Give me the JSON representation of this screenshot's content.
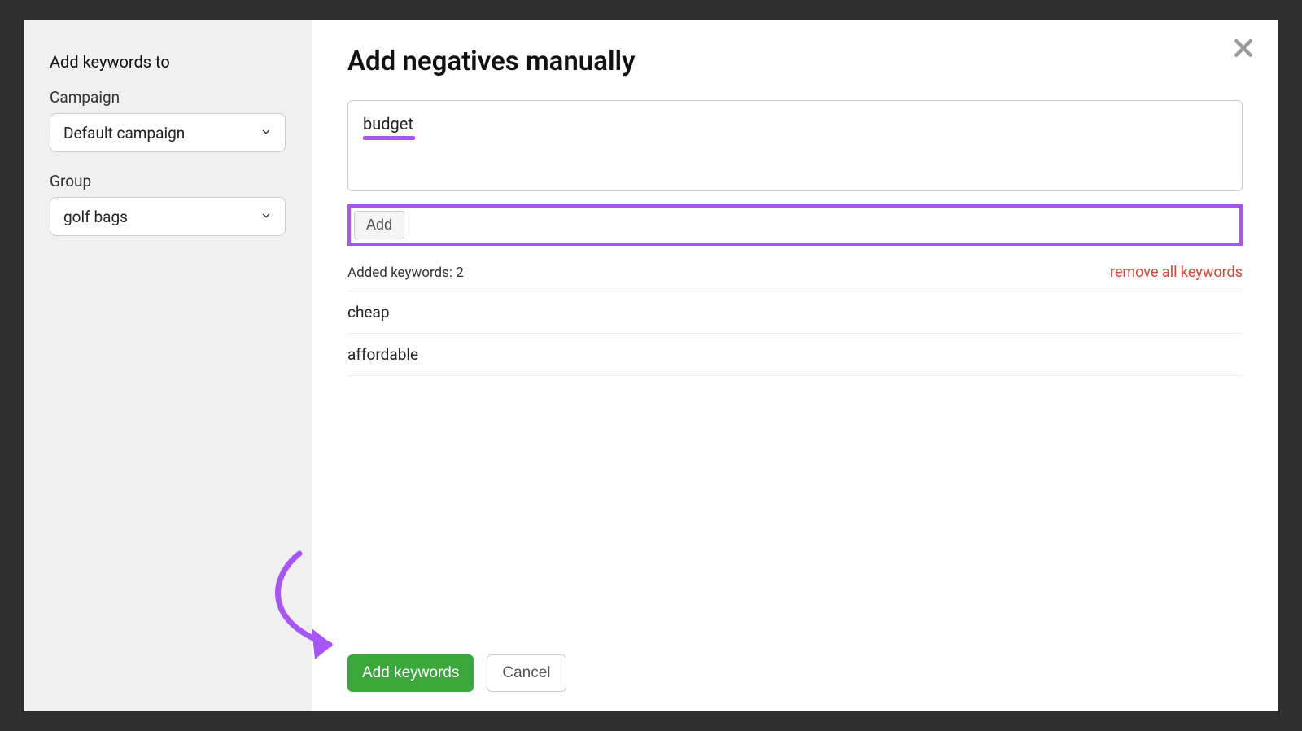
{
  "sidebar": {
    "title": "Add keywords to",
    "campaign_label": "Campaign",
    "campaign_value": "Default campaign",
    "group_label": "Group",
    "group_value": "golf bags"
  },
  "main": {
    "title": "Add negatives manually",
    "textarea_value": "budget",
    "add_button_label": "Add",
    "added_count_label": "Added keywords: 2",
    "remove_all_label": "remove all keywords",
    "keywords": [
      "cheap",
      "affordable"
    ]
  },
  "footer": {
    "primary_label": "Add keywords",
    "cancel_label": "Cancel"
  },
  "annotations": {
    "accent_color": "#a855f7"
  }
}
